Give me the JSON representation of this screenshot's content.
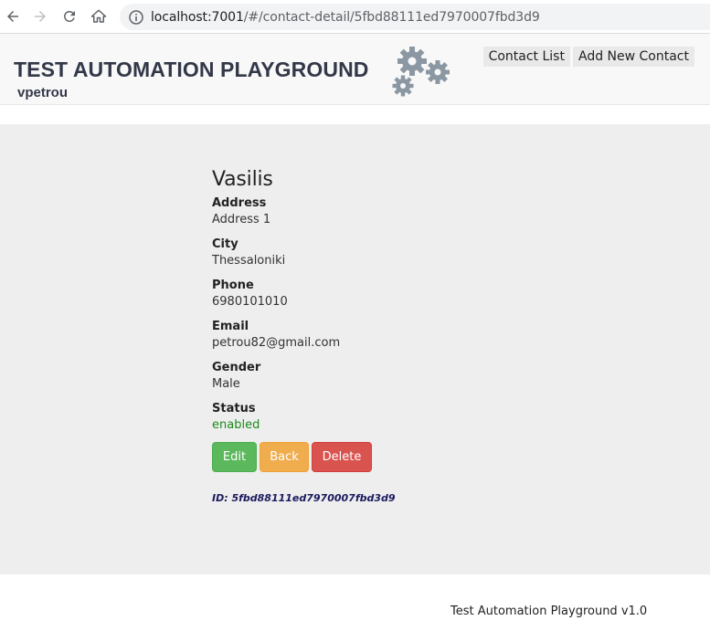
{
  "browser": {
    "url_host": "localhost:7001",
    "url_path": "/#/contact-detail/5fbd88111ed7970007fbd3d9"
  },
  "header": {
    "brand": "TEST AUTOMATION PLAYGROUND",
    "username": "vpetrou",
    "nav": {
      "contact_list": "Contact List",
      "add_new_contact": "Add New Contact"
    }
  },
  "contact": {
    "name": "Vasilis",
    "fields": {
      "address_label": "Address",
      "address_value": "Address 1",
      "city_label": "City",
      "city_value": "Thessaloniki",
      "phone_label": "Phone",
      "phone_value": "6980101010",
      "email_label": "Email",
      "email_value": "petrou82@gmail.com",
      "gender_label": "Gender",
      "gender_value": "Male",
      "status_label": "Status",
      "status_value": "enabled"
    },
    "buttons": {
      "edit": "Edit",
      "back": "Back",
      "delete": "Delete"
    },
    "id_text": "ID: 5fbd88111ed7970007fbd3d9"
  },
  "footer": {
    "text": "Test Automation Playground v1.0"
  },
  "colors": {
    "edit": "#5cb85c",
    "back": "#f0ad4e",
    "delete": "#d9534f",
    "status_enabled": "#1a8a1a",
    "content_bg": "#eeeeee"
  },
  "icons": [
    "back-arrow-icon",
    "forward-arrow-icon",
    "reload-icon",
    "home-icon",
    "info-icon",
    "gears-icon"
  ]
}
